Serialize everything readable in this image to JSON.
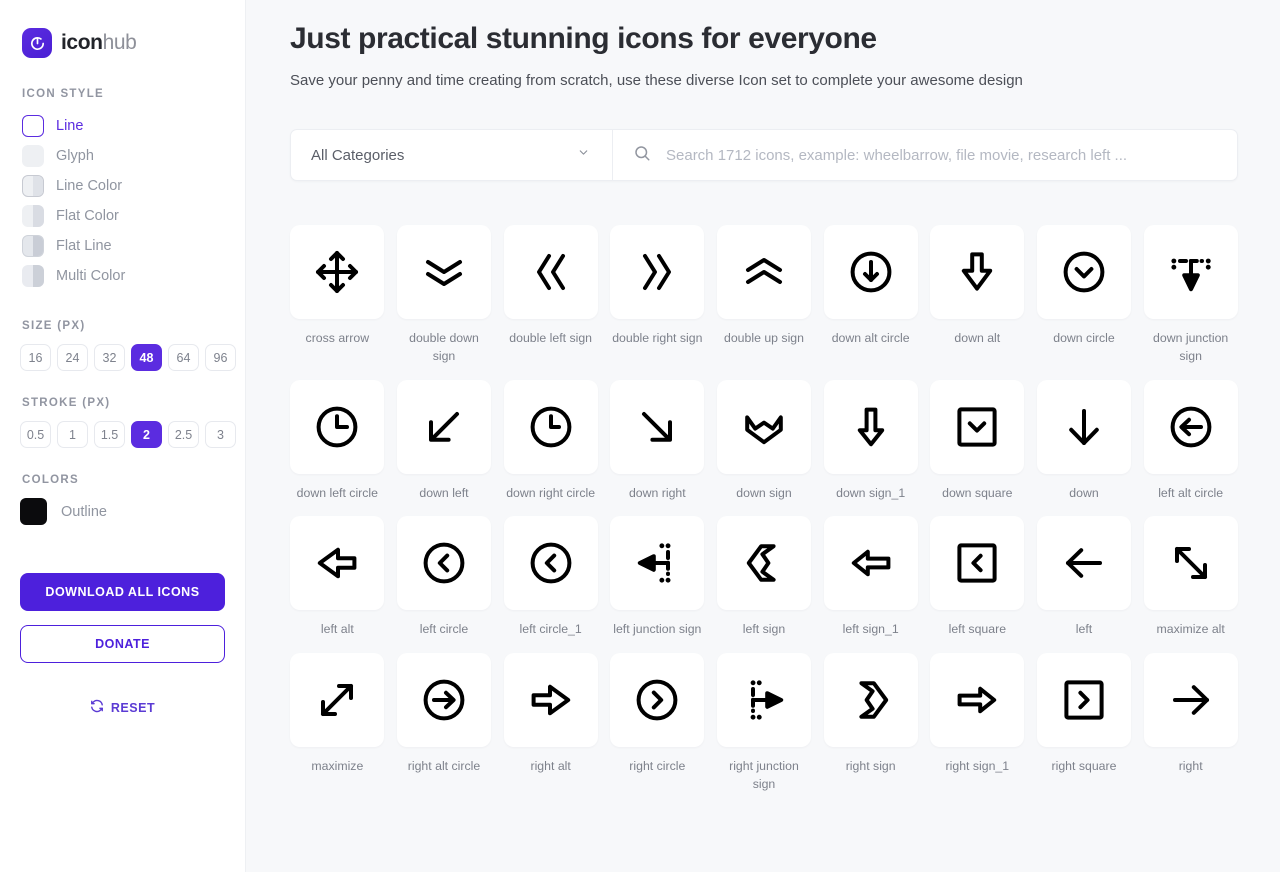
{
  "brand": {
    "name_bold": "icon",
    "name_light": "hub",
    "logo_icon": "refresh-circle-icon",
    "logo_color": "#4a1fd4"
  },
  "sidebar": {
    "icon_style_title": "ICON STYLE",
    "styles": [
      {
        "label": "Line",
        "selected": true
      },
      {
        "label": "Glyph",
        "selected": false
      },
      {
        "label": "Line Color",
        "selected": false
      },
      {
        "label": "Flat Color",
        "selected": false
      },
      {
        "label": "Flat Line",
        "selected": false
      },
      {
        "label": "Multi Color",
        "selected": false
      }
    ],
    "size_title": "SIZE (PX)",
    "sizes": [
      "16",
      "24",
      "32",
      "48",
      "64",
      "96"
    ],
    "size_selected": "48",
    "stroke_title": "STROKE (PX)",
    "strokes": [
      "0.5",
      "1",
      "1.5",
      "2",
      "2.5",
      "3"
    ],
    "stroke_selected": "2",
    "colors_title": "COLORS",
    "color_name": "Outline",
    "color_value": "#0b0b0d",
    "download_label": "DOWNLOAD ALL ICONS",
    "donate_label": "DONATE",
    "reset_label": "RESET",
    "accent": "#4d20dc"
  },
  "header": {
    "title": "Just practical stunning icons for everyone",
    "subtitle": "Save your penny and time creating from scratch, use these diverse Icon set to complete your awesome design"
  },
  "search": {
    "category_value": "All Categories",
    "placeholder": "Search 1712 icons, example: wheelbarrow, file movie, research left ...",
    "value": ""
  },
  "icons": [
    {
      "label": "cross arrow",
      "glyph": "cross-arrow"
    },
    {
      "label": "double down sign",
      "glyph": "double-down-sign"
    },
    {
      "label": "double left sign",
      "glyph": "double-left-sign"
    },
    {
      "label": "double right sign",
      "glyph": "double-right-sign"
    },
    {
      "label": "double up sign",
      "glyph": "double-up-sign"
    },
    {
      "label": "down alt circle",
      "glyph": "down-alt-circle"
    },
    {
      "label": "down alt",
      "glyph": "down-alt"
    },
    {
      "label": "down circle",
      "glyph": "down-circle"
    },
    {
      "label": "down junction sign",
      "glyph": "down-junction-sign"
    },
    {
      "label": "down left circle",
      "glyph": "down-left-circle"
    },
    {
      "label": "down left",
      "glyph": "down-left"
    },
    {
      "label": "down right circle",
      "glyph": "down-right-circle"
    },
    {
      "label": "down right",
      "glyph": "down-right"
    },
    {
      "label": "down sign",
      "glyph": "down-sign"
    },
    {
      "label": "down sign_1",
      "glyph": "down-sign-1"
    },
    {
      "label": "down square",
      "glyph": "down-square"
    },
    {
      "label": "down",
      "glyph": "down"
    },
    {
      "label": "left alt circle",
      "glyph": "left-alt-circle"
    },
    {
      "label": "left alt",
      "glyph": "left-alt"
    },
    {
      "label": "left circle",
      "glyph": "left-circle"
    },
    {
      "label": "left circle_1",
      "glyph": "left-circle-1"
    },
    {
      "label": "left junction sign",
      "glyph": "left-junction-sign"
    },
    {
      "label": "left sign",
      "glyph": "left-sign"
    },
    {
      "label": "left sign_1",
      "glyph": "left-sign-1"
    },
    {
      "label": "left square",
      "glyph": "left-square"
    },
    {
      "label": "left",
      "glyph": "left"
    },
    {
      "label": "maximize alt",
      "glyph": "maximize-alt"
    },
    {
      "label": "maximize",
      "glyph": "maximize"
    },
    {
      "label": "right alt circle",
      "glyph": "right-alt-circle"
    },
    {
      "label": "right alt",
      "glyph": "right-alt"
    },
    {
      "label": "right circle",
      "glyph": "right-circle"
    },
    {
      "label": "right junction sign",
      "glyph": "right-junction-sign"
    },
    {
      "label": "right sign",
      "glyph": "right-sign"
    },
    {
      "label": "right sign_1",
      "glyph": "right-sign-1"
    },
    {
      "label": "right square",
      "glyph": "right-square"
    },
    {
      "label": "right",
      "glyph": "right"
    }
  ]
}
